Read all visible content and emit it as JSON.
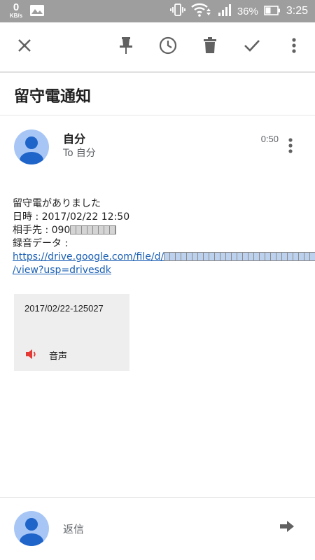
{
  "status_bar": {
    "net_speed": "0",
    "net_speed_unit": "KB/s",
    "battery_percent": "36%",
    "time": "3:25"
  },
  "toolbar": {
    "icons": [
      "close-icon",
      "pin-icon",
      "snooze-clock-icon",
      "delete-icon",
      "done-check-icon",
      "more-vert-icon"
    ]
  },
  "email": {
    "subject": "留守電通知",
    "sender": {
      "name": "自分",
      "to_label": "To",
      "to_value": "自分"
    },
    "time": "0:50",
    "body": {
      "line1": "留守電がありました",
      "line2": "日時 : 2017/02/22 12:50",
      "line3_prefix": "相手先 : 090",
      "line4": "録音データ :",
      "link_prefix": "https://drive.google.com/file/d/",
      "link_suffix": "/view?usp=drivesdk"
    },
    "attachment": {
      "name": "2017/02/22-125027",
      "type_label": "音声"
    }
  },
  "reply": {
    "placeholder": "返信"
  },
  "colors": {
    "status_bar_bg": "#9e9e9e",
    "avatar_bg": "#a8c6f5",
    "avatar_fg": "#1f64c9",
    "link": "#1a5fb4",
    "audio_icon": "#e53935",
    "toolbar_icon": "#616161"
  }
}
